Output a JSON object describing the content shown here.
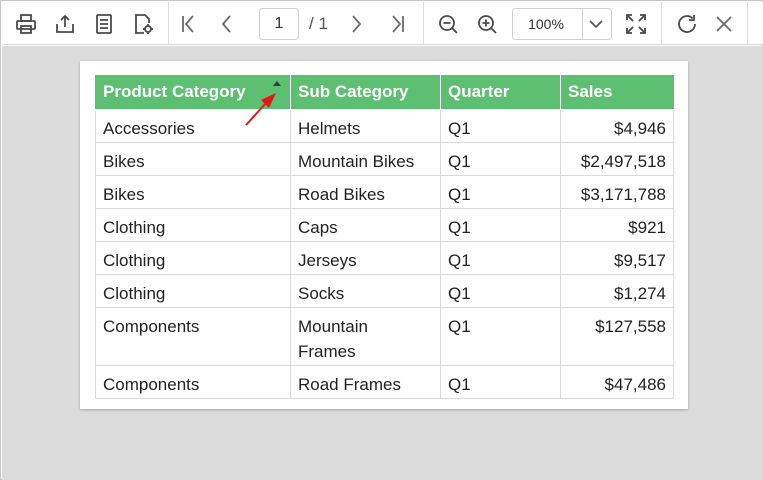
{
  "toolbar": {
    "page_current": "1",
    "page_total": "/ 1",
    "zoom": "100%",
    "icons": [
      "print-icon",
      "export-icon",
      "document-icon",
      "page-setup-icon",
      "first-page-icon",
      "prev-page-icon",
      "next-page-icon",
      "last-page-icon",
      "zoom-out-icon",
      "zoom-in-icon",
      "fit-page-icon",
      "refresh-icon",
      "close-icon"
    ]
  },
  "table": {
    "columns": [
      "Product Category",
      "Sub Category",
      "Quarter",
      "Sales"
    ],
    "rows": [
      [
        "Accessories",
        "Helmets",
        "Q1",
        "$4,946"
      ],
      [
        "Bikes",
        "Mountain Bikes",
        "Q1",
        "$2,497,518"
      ],
      [
        "Bikes",
        "Road Bikes",
        "Q1",
        "$3,171,788"
      ],
      [
        "Clothing",
        "Caps",
        "Q1",
        "$921"
      ],
      [
        "Clothing",
        "Jerseys",
        "Q1",
        "$9,517"
      ],
      [
        "Clothing",
        "Socks",
        "Q1",
        "$1,274"
      ],
      [
        "Components",
        "Mountain Frames",
        "Q1",
        "$127,558"
      ],
      [
        "Components",
        "Road Frames",
        "Q1",
        "$47,486"
      ]
    ]
  },
  "colors": {
    "header": "#5cbf72",
    "annotation_arrow": "#e8141c"
  }
}
